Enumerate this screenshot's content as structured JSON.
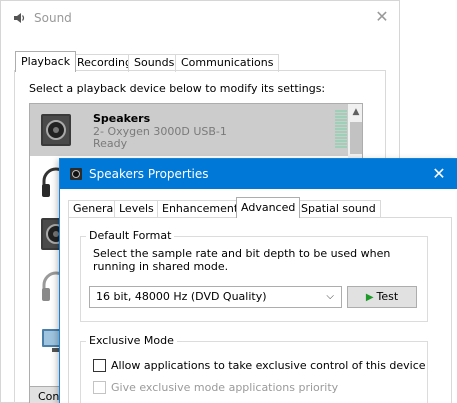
{
  "sound_window": {
    "title": "Sound",
    "close_glyph": "✕",
    "app_icon": "speaker-icon",
    "tabs": [
      {
        "label": "Playback"
      },
      {
        "label": "Recording"
      },
      {
        "label": "Sounds"
      },
      {
        "label": "Communications"
      }
    ],
    "instruction": "Select a playback device below to modify its settings:",
    "devices": [
      {
        "name": "Speakers",
        "detail": "2- Oxygen 3000D USB-1",
        "status": "Ready",
        "icon": "speaker-device-icon",
        "selected": true
      },
      {
        "icon": "headphones-icon"
      },
      {
        "icon": "speaker-device-icon"
      },
      {
        "icon": "headphones-icon"
      },
      {
        "icon": "monitor-speaker-icon"
      }
    ],
    "scroll_up_glyph": "▲",
    "configure_label": "Configure"
  },
  "properties_window": {
    "title": "Speakers Properties",
    "close_glyph": "✕",
    "app_icon": "speaker-icon",
    "title_bar_color": "#0078d7",
    "tabs": [
      {
        "label": "General"
      },
      {
        "label": "Levels"
      },
      {
        "label": "Enhancements"
      },
      {
        "label": "Advanced",
        "active": true
      },
      {
        "label": "Spatial sound"
      }
    ],
    "default_format": {
      "label": "Default Format",
      "description": "Select the sample rate and bit depth to be used when running in shared mode.",
      "selected_format": "16 bit, 48000 Hz (DVD Quality)",
      "dropdown_glyph": "⌵",
      "test_label": "Test",
      "test_glyph": "▶"
    },
    "exclusive_mode": {
      "label": "Exclusive Mode",
      "allow_label": "Allow applications to take exclusive control of this device",
      "allow_checked": false,
      "priority_label": "Give exclusive mode applications priority",
      "priority_checked": false,
      "priority_enabled": false
    }
  }
}
